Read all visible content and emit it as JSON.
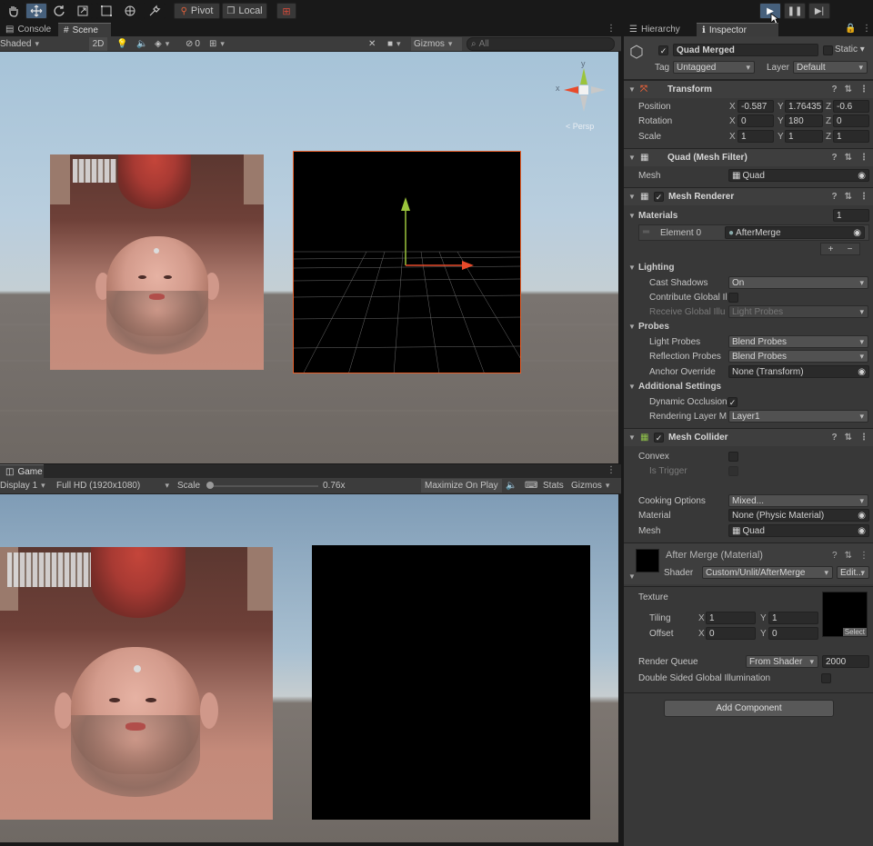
{
  "toolbar": {
    "pivot_label": "Pivot",
    "local_label": "Local"
  },
  "scene_panel": {
    "tabs": [
      "Console",
      "Scene"
    ],
    "shading_mode": "Shaded",
    "mode_2d": "2D",
    "hidden_count": "0",
    "gizmos_label": "Gizmos",
    "search_placeholder": "All",
    "gizmo_projection": "< Persp",
    "axis_y": "y",
    "axis_x": "x"
  },
  "game_panel": {
    "tab": "Game",
    "display": "Display 1",
    "resolution": "Full HD (1920x1080)",
    "scale_label": "Scale",
    "scale_value": "0.76x",
    "maximize_label": "Maximize On Play",
    "stats_label": "Stats",
    "gizmos_label": "Gizmos"
  },
  "inspector": {
    "tabs": [
      "Hierarchy",
      "Inspector"
    ],
    "object_name": "Quad Merged",
    "static_label": "Static",
    "tag_label": "Tag",
    "tag_value": "Untagged",
    "layer_label": "Layer",
    "layer_value": "Default",
    "transform": {
      "title": "Transform",
      "position_label": "Position",
      "rotation_label": "Rotation",
      "scale_label": "Scale",
      "position": [
        "-0.587",
        "1.76435",
        "-0.6"
      ],
      "rotation": [
        "0",
        "180",
        "0"
      ],
      "scale": [
        "1",
        "1",
        "1"
      ]
    },
    "mesh_filter": {
      "title": "Quad (Mesh Filter)",
      "mesh_label": "Mesh",
      "mesh_value": "Quad"
    },
    "mesh_renderer": {
      "title": "Mesh Renderer",
      "materials_label": "Materials",
      "materials_count": "1",
      "element0_label": "Element 0",
      "element0_value": "AfterMerge",
      "lighting_label": "Lighting",
      "cast_shadows_label": "Cast Shadows",
      "cast_shadows_value": "On",
      "contribute_gi_label": "Contribute Global Il",
      "receive_gi_label": "Receive Global Illu",
      "receive_gi_value": "Light Probes",
      "probes_label": "Probes",
      "light_probes_label": "Light Probes",
      "light_probes_value": "Blend Probes",
      "reflection_probes_label": "Reflection Probes",
      "reflection_probes_value": "Blend Probes",
      "anchor_override_label": "Anchor Override",
      "anchor_override_value": "None (Transform)",
      "additional_label": "Additional Settings",
      "dynamic_occlusion_label": "Dynamic Occlusion",
      "rendering_layer_label": "Rendering Layer M",
      "rendering_layer_value": "Layer1"
    },
    "mesh_collider": {
      "title": "Mesh Collider",
      "convex_label": "Convex",
      "is_trigger_label": "Is Trigger",
      "cooking_label": "Cooking Options",
      "cooking_value": "Mixed...",
      "material_label": "Material",
      "material_value": "None (Physic Material)",
      "mesh_label": "Mesh",
      "mesh_value": "Quad"
    },
    "material": {
      "title": "After Merge (Material)",
      "shader_label": "Shader",
      "shader_value": "Custom/Unlit/AfterMerge",
      "edit_label": "Edit...",
      "texture_label": "Texture",
      "tiling_label": "Tiling",
      "tiling": [
        "1",
        "1"
      ],
      "offset_label": "Offset",
      "offset": [
        "0",
        "0"
      ],
      "select_label": "Select",
      "render_queue_label": "Render Queue",
      "render_queue_mode": "From Shader",
      "render_queue_value": "2000",
      "double_sided_label": "Double Sided Global Illumination"
    },
    "add_component_label": "Add Component"
  },
  "axis_labels": {
    "x": "X",
    "y": "Y",
    "z": "Z"
  },
  "colors": {
    "accent_selected": "#46607c",
    "selection_outline": "#e8602c",
    "axis_x": "#e84a2a",
    "axis_y": "#9bc43c",
    "panel_bg": "#383838"
  }
}
